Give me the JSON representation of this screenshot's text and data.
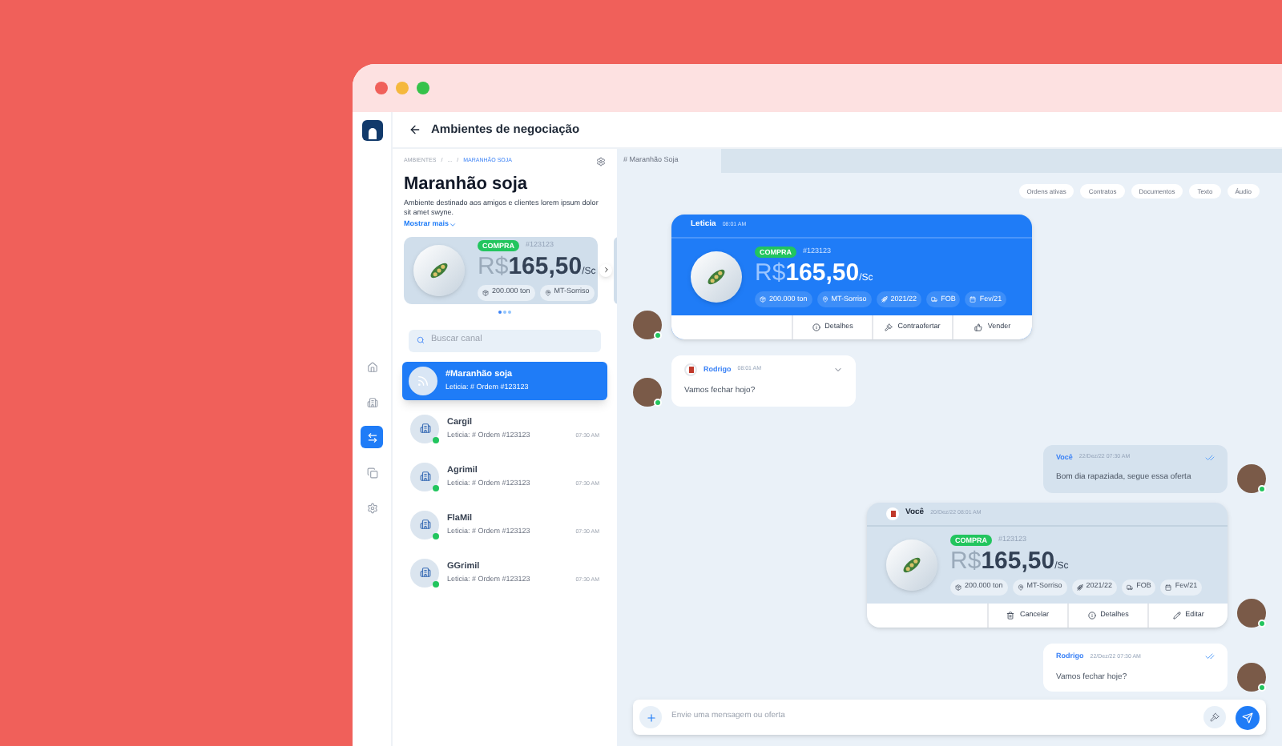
{
  "header": {
    "title": "Ambientes de negociação"
  },
  "nav": [
    {
      "selected": false
    },
    {
      "selected": false
    },
    {
      "selected": true
    },
    {
      "selected": false
    },
    {
      "selected": false
    }
  ],
  "panel": {
    "breadcrumb": [
      "AMBIENTES",
      "/",
      "...",
      "/",
      "MARANHÃO SOJA"
    ],
    "title": "Maranhão soja",
    "description": "Ambiente destinado aos amigos e clientes lorem ipsum dolor sit amet swyne.",
    "show_more": "Mostrar mais",
    "offer": {
      "badge": "COMPRA",
      "order": "#123123",
      "currency": "R$",
      "price": "165,50",
      "unit": "/Sc",
      "chips": [
        "200.000 ton",
        "MT-Sorriso"
      ]
    },
    "search": {
      "placeholder": "Buscar canal"
    },
    "channels": [
      {
        "name": "#Maranhão soja",
        "last": "Leticia: # Ordem #123123",
        "kind": "broadcast",
        "selected": true,
        "online": false
      },
      {
        "name": "Cargil",
        "last": "Leticia: # Ordem #123123",
        "time": "07:30 AM",
        "kind": "company",
        "selected": false,
        "online": true
      },
      {
        "name": "Agrimil",
        "last": "Leticia: # Ordem #123123",
        "time": "07:30 AM",
        "kind": "company",
        "selected": false,
        "online": true
      },
      {
        "name": "FlaMil",
        "last": "Leticia: # Ordem #123123",
        "time": "07:30 AM",
        "kind": "company",
        "selected": false,
        "online": true
      },
      {
        "name": "GGrimil",
        "last": "Leticia: # Ordem #123123",
        "time": "07:30 AM",
        "kind": "company",
        "selected": false,
        "online": true
      }
    ]
  },
  "chat": {
    "tabs": [
      {
        "label": "# Maranhão Soja",
        "selected": true
      }
    ],
    "filters": [
      "Ordens ativas",
      "Contratos",
      "Documentos",
      "Texto",
      "Áudio"
    ],
    "messages": [
      {
        "kind": "offer",
        "mine": false,
        "author": "Leticia",
        "time": "08:01 AM",
        "badge": "COMPRA",
        "order": "#123123",
        "currency": "R$",
        "price": "165,50",
        "unit": "/Sc",
        "chips": [
          "200.000 ton",
          "MT-Sorriso",
          "2021/22",
          "FOB",
          "Fev/21"
        ],
        "actions": [
          "Detalhes",
          "Contraofertar",
          "Vender"
        ]
      },
      {
        "kind": "text",
        "mine": false,
        "author": "Rodrigo",
        "time": "08:01 AM",
        "text": "Vamos fechar hojo?"
      },
      {
        "kind": "text",
        "mine": true,
        "author": "Você",
        "time": "22/Dez/22 07:30 AM",
        "text": "Bom dia rapaziada, segue essa oferta",
        "read": true
      },
      {
        "kind": "offer",
        "mine": true,
        "author": "Você",
        "time": "20/Dez/22 08:01 AM",
        "badge": "COMPRA",
        "order": "#123123",
        "currency": "R$",
        "price": "165,50",
        "unit": "/Sc",
        "chips": [
          "200.000 ton",
          "MT-Sorriso",
          "2021/22",
          "FOB",
          "Fev/21"
        ],
        "actions": [
          "Cancelar",
          "Detalhes",
          "Editar"
        ]
      },
      {
        "kind": "text",
        "mine": true,
        "author": "Rodrigo",
        "time": "22/Dez/22 07:30 AM",
        "text": "Vamos fechar hoje?",
        "read": true
      }
    ],
    "composer": {
      "placeholder": "Envie uma mensagem ou oferta"
    }
  }
}
